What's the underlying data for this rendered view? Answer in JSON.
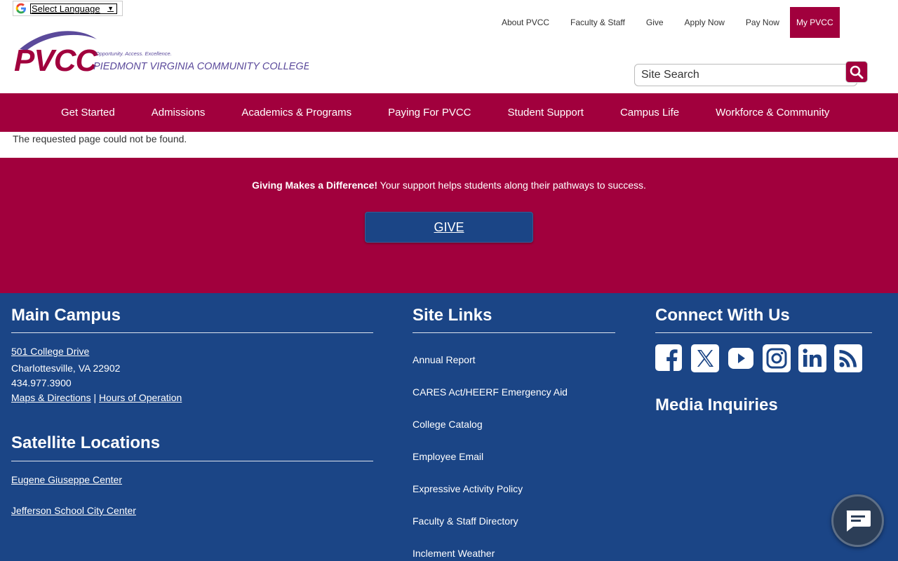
{
  "language": {
    "label": "Select Language",
    "icon": "google-g-icon"
  },
  "logo": {
    "wordmark": "PVCC",
    "tagline": "Opportunity. Access. Excellence.",
    "college_name": "PIEDMONT VIRGINIA COMMUNITY COLLEGE"
  },
  "util_nav": {
    "about": "About PVCC",
    "faculty": "Faculty & Staff",
    "give": "Give",
    "apply": "Apply Now",
    "pay": "Pay Now",
    "mypvcc": "My PVCC"
  },
  "search": {
    "placeholder": "Site Search",
    "icon": "search-icon"
  },
  "main_nav": {
    "items": [
      "Get Started",
      "Admissions",
      "Academics & Programs",
      "Paying For PVCC",
      "Student Support",
      "Campus Life",
      "Workforce & Community"
    ]
  },
  "content": {
    "message": "The requested page could not be found."
  },
  "give_band": {
    "bold": "Giving Makes a Difference!",
    "text": " Your support helps students along their pathways to success.",
    "button": "GIVE"
  },
  "footer": {
    "main_campus": {
      "heading": "Main Campus",
      "address_link": "501 College Drive",
      "city": "Charlottesville, VA 22902",
      "phone": "434.977.3900",
      "maps_link": "Maps & Directions",
      "separator": "|",
      "hours_link": "Hours of Operation"
    },
    "satellite": {
      "heading": "Satellite Locations",
      "items": [
        "Eugene Giuseppe Center",
        "Jefferson School City Center"
      ]
    },
    "site_links": {
      "heading": "Site Links",
      "items": [
        "Annual Report",
        "CARES Act/HEERF Emergency Aid",
        "College Catalog",
        "Employee Email",
        "Expressive Activity Policy",
        "Faculty & Staff Directory",
        "Inclement Weather"
      ]
    },
    "connect": {
      "heading": "Connect With Us",
      "social": [
        "facebook-icon",
        "x-twitter-icon",
        "youtube-icon",
        "instagram-icon",
        "linkedin-icon",
        "rss-icon"
      ]
    },
    "media": {
      "heading": "Media Inquiries"
    }
  },
  "colors": {
    "brand_maroon": "#a1003d",
    "brand_navy": "#1b4586",
    "logo_purple": "#5b4a9b"
  }
}
